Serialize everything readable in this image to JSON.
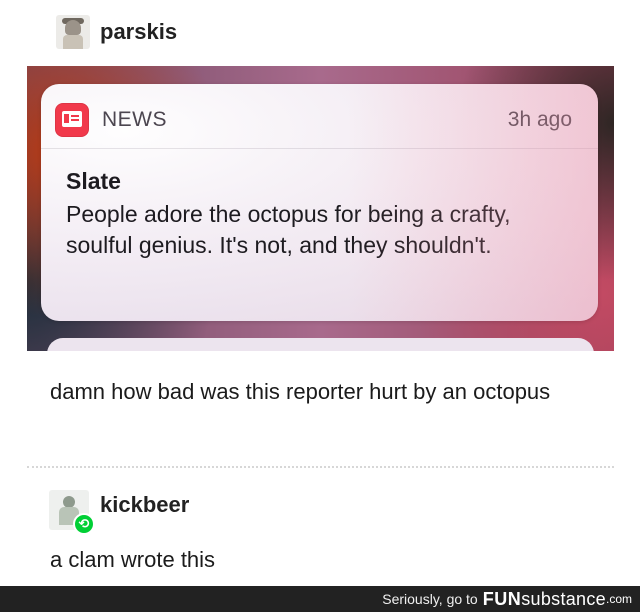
{
  "post1": {
    "username": "parskis",
    "notification": {
      "app_name": "NEWS",
      "time": "3h ago",
      "source": "Slate",
      "headline": "People adore the octopus for being a crafty, soulful genius. It's not, and they shouldn't."
    },
    "comment": "damn how bad was this reporter hurt by an octopus"
  },
  "post2": {
    "username": "kickbeer",
    "reply": "a clam wrote this",
    "badge_icon": "reblog-icon"
  },
  "footer": {
    "text": "Seriously, go to",
    "brand_fun": "FUN",
    "brand_sub": "substance",
    "brand_com": ".com"
  },
  "colors": {
    "news_icon": "#f1394b",
    "reblog_badge": "#00cf35",
    "footer_bg": "#222222"
  }
}
